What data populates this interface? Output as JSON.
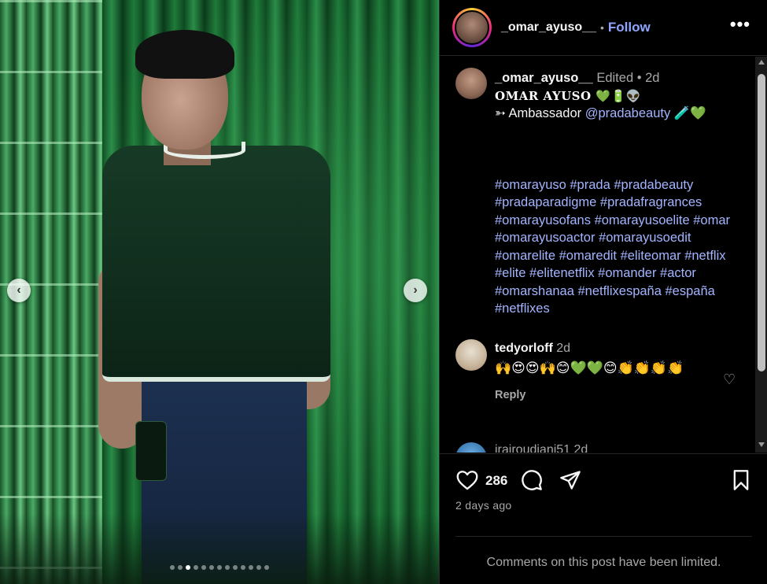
{
  "media": {
    "active_slide": 3,
    "slide_count": 13,
    "prev_arrow": "‹",
    "next_arrow": "›"
  },
  "header": {
    "username": "_omar_ayuso__",
    "separator": "•",
    "follow_label": "Follow",
    "more_label": "•••"
  },
  "caption": {
    "username": "_omar_ayuso__",
    "meta": " Edited • 2d",
    "title": "OMAR AYUSO 💚🔋👽",
    "ambassador_prefix": "➳ Ambassador ",
    "mention": "@pradabeauty",
    "ambassador_suffix": " 🧪💚",
    "hashtags": "#omarayuso #prada #pradabeauty #pradaparadigme #pradafragrances #omarayusofans #omarayusoelite #omar #omarayusoactor #omarayusoedit #omarelite #omaredit #eliteomar #netflix #elite #elitenetflix #omander #actor #omarshanaa #netflixespaña #españa #netflixes"
  },
  "comments": [
    {
      "username": "tedyorloff",
      "time": "2d",
      "text": "🙌😍😍🙌😊💚💚😊👏👏👏👏",
      "reply_label": "Reply",
      "like_icon": "♡"
    },
    {
      "username": "irairoudiani51",
      "time": "2d"
    }
  ],
  "actions": {
    "like_count": "286",
    "posted": "2 days ago",
    "limited_notice": "Comments on this post have been limited."
  },
  "colors": {
    "link": "#a3b4ff",
    "follow": "#8fa5ff",
    "muted": "#a8a8a8",
    "background": "#000000"
  }
}
